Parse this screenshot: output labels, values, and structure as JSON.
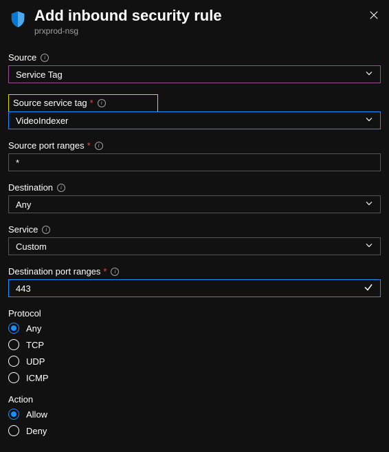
{
  "header": {
    "title": "Add inbound security rule",
    "subtitle": "prxprod-nsg"
  },
  "fields": {
    "source": {
      "label": "Source",
      "value": "Service Tag"
    },
    "source_service_tag": {
      "label": "Source service tag",
      "value": "VideoIndexer"
    },
    "source_port_ranges": {
      "label": "Source port ranges",
      "value": "*"
    },
    "destination": {
      "label": "Destination",
      "value": "Any"
    },
    "service": {
      "label": "Service",
      "value": "Custom"
    },
    "destination_port_ranges": {
      "label": "Destination port ranges",
      "value": "443"
    },
    "protocol": {
      "label": "Protocol",
      "options": [
        "Any",
        "TCP",
        "UDP",
        "ICMP"
      ],
      "selected": "Any"
    },
    "action": {
      "label": "Action",
      "options": [
        "Allow",
        "Deny"
      ],
      "selected": "Allow"
    }
  }
}
